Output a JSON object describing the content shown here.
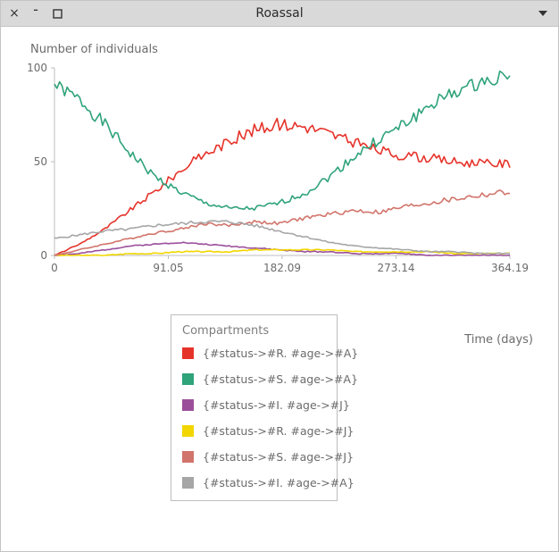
{
  "window": {
    "title": "Roassal"
  },
  "chart_data": {
    "type": "line",
    "title": "",
    "xlabel": "Time (days)",
    "ylabel": "Number of individuals",
    "xlim": [
      0,
      364.19
    ],
    "ylim": [
      0,
      100
    ],
    "x_ticks": [
      0.0,
      91.05,
      182.09,
      273.14,
      364.19
    ],
    "y_ticks": [
      0,
      50,
      100
    ],
    "x": [
      0,
      20,
      40,
      60,
      80,
      100,
      120,
      140,
      160,
      180,
      200,
      220,
      240,
      260,
      280,
      300,
      320,
      340,
      364.19
    ],
    "series": [
      {
        "name": "{#status->#R. #age->#A}",
        "color": "#e6332a",
        "values": [
          0,
          6,
          14,
          24,
          34,
          45,
          54,
          61,
          67,
          70,
          69,
          65,
          60,
          56,
          53,
          52,
          50,
          49,
          49
        ]
      },
      {
        "name": "{#status->#S. #age->#A}",
        "color": "#2fa37a",
        "values": [
          91,
          83,
          70,
          55,
          42,
          34,
          28,
          25,
          25,
          28,
          33,
          42,
          53,
          62,
          70,
          80,
          87,
          92,
          97
        ]
      },
      {
        "name": "{#status->#I. #age->#J}",
        "color": "#9b4f9b",
        "values": [
          0,
          1,
          3,
          5,
          6,
          7,
          6,
          5,
          4,
          3,
          2,
          2,
          1,
          1,
          1,
          0,
          0,
          0,
          0
        ]
      },
      {
        "name": "{#status->#R. #age->#J}",
        "color": "#f2d600",
        "values": [
          0,
          0,
          0,
          1,
          1,
          2,
          2,
          2,
          3,
          3,
          3,
          3,
          2,
          2,
          2,
          2,
          1,
          1,
          1
        ]
      },
      {
        "name": "{#status->#S. #age->#J}",
        "color": "#d1746b",
        "values": [
          0,
          3,
          6,
          9,
          12,
          14,
          17,
          16,
          18,
          17,
          20,
          22,
          24,
          23,
          26,
          28,
          30,
          32,
          34
        ]
      },
      {
        "name": "{#status->#I. #age->#A}",
        "color": "#a6a6a6",
        "values": [
          9,
          11,
          13,
          14,
          16,
          17,
          18,
          18,
          16,
          13,
          10,
          7,
          5,
          4,
          3,
          2,
          2,
          1,
          1
        ]
      }
    ],
    "legend_title": "Compartments"
  },
  "icons": {
    "close": "close-icon",
    "minimize": "minimize-icon",
    "maximize": "maximize-icon",
    "menu": "menu-icon"
  }
}
